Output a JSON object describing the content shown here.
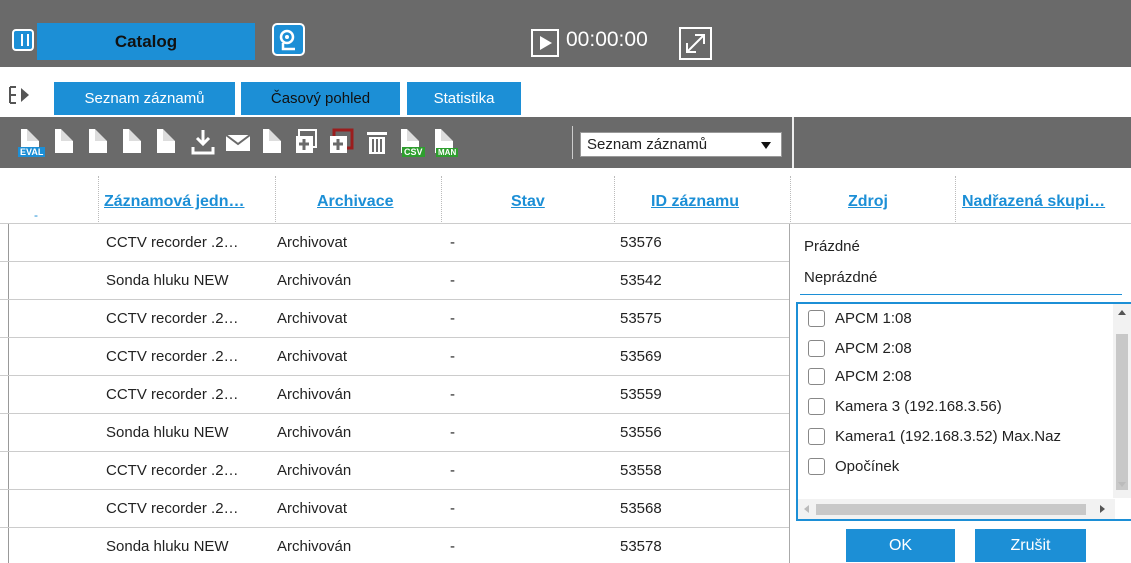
{
  "header": {
    "catalog_label": "Catalog",
    "time": "00:00:00"
  },
  "tabs": [
    {
      "label": "Seznam záznamů"
    },
    {
      "label": "Časový pohled"
    },
    {
      "label": "Statistika"
    }
  ],
  "toolbar": {
    "eval_tag": "EVAL",
    "csv_tag": "CSV",
    "man_tag": "MAN",
    "view_select": "Seznam záznamů"
  },
  "table": {
    "columns": [
      "Záznamová jedn…",
      "Archivace",
      "Stav",
      "ID záznamu",
      "Zdroj",
      "Nadřazená skupi…"
    ],
    "rows": [
      {
        "unit": "CCTV recorder .2…",
        "archive": "Archivovat",
        "status": "-",
        "id": "53576"
      },
      {
        "unit": "Sonda hluku NEW",
        "archive": "Archivován",
        "status": "-",
        "id": "53542"
      },
      {
        "unit": "CCTV recorder .2…",
        "archive": "Archivovat",
        "status": "-",
        "id": "53575"
      },
      {
        "unit": "CCTV recorder .2…",
        "archive": "Archivovat",
        "status": "-",
        "id": "53569"
      },
      {
        "unit": "CCTV recorder .2…",
        "archive": "Archivován",
        "status": "-",
        "id": "53559"
      },
      {
        "unit": "Sonda hluku NEW",
        "archive": "Archivován",
        "status": "-",
        "id": "53556"
      },
      {
        "unit": "CCTV recorder .2…",
        "archive": "Archivován",
        "status": "-",
        "id": "53558"
      },
      {
        "unit": "CCTV recorder .2…",
        "archive": "Archivovat",
        "status": "-",
        "id": "53568"
      },
      {
        "unit": "Sonda hluku NEW",
        "archive": "Archivován",
        "status": "-",
        "id": "53578"
      }
    ]
  },
  "filter": {
    "empty_label": "Prázdné",
    "nonempty_label": "Neprázdné",
    "options": [
      "APCM 1:08",
      "APCM 2:08",
      "APCM 2:08",
      "Kamera 3 (192.168.3.56)",
      "Kamera1 (192.168.3.52) Max.Naz",
      "Opočínek"
    ],
    "ok_label": "OK",
    "cancel_label": "Zrušit"
  },
  "colors": {
    "accent": "#1c8fd6",
    "toolbar": "#6a6a6a"
  }
}
